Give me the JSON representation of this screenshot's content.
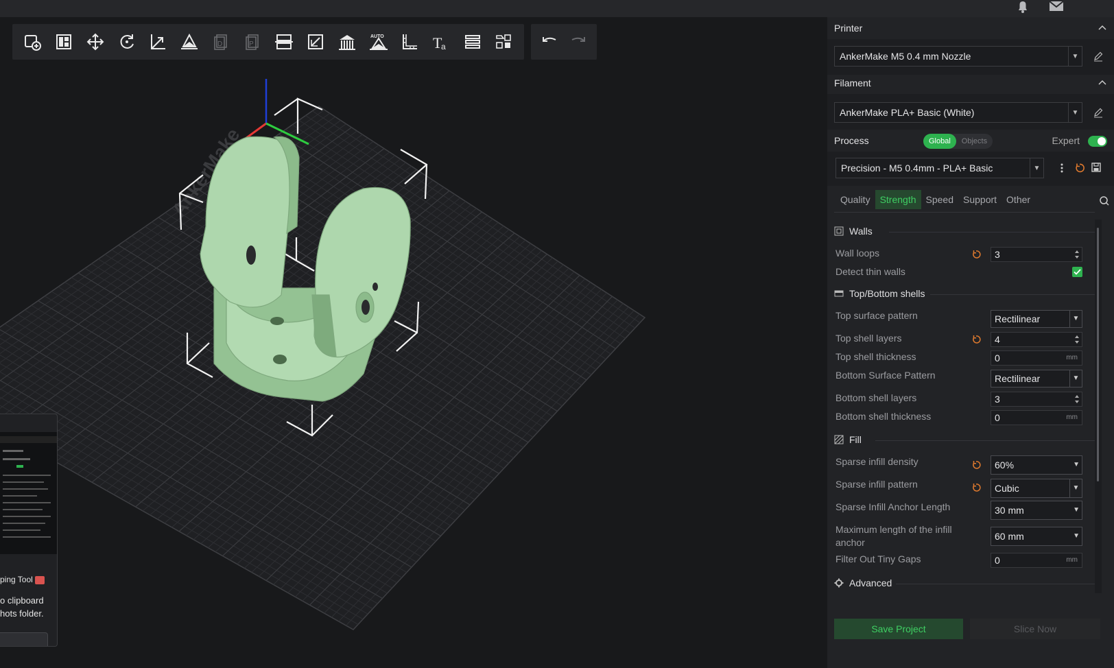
{
  "colors": {
    "accent": "#2eb24f",
    "accent_text": "#3fcf63",
    "model": "#a9d4a8",
    "reset_icon": "#e07a2e",
    "axis_x": "#e53935",
    "axis_y": "#2ecc40",
    "axis_z": "#1e3fd8"
  },
  "topbar": {
    "icons": [
      "bell-icon",
      "mail-icon"
    ]
  },
  "toolbar": {
    "tools": [
      {
        "name": "add-object-icon",
        "state": "enabled"
      },
      {
        "name": "arrange-icon",
        "state": "enabled"
      },
      {
        "name": "move-icon",
        "state": "enabled"
      },
      {
        "name": "rotate-icon",
        "state": "enabled"
      },
      {
        "name": "scale-icon",
        "state": "enabled"
      },
      {
        "name": "lay-on-face-icon",
        "state": "enabled"
      },
      {
        "name": "copy-icon",
        "state": "disabled"
      },
      {
        "name": "paste-icon",
        "state": "disabled"
      },
      {
        "name": "split-icon",
        "state": "enabled"
      },
      {
        "name": "cut-icon",
        "state": "enabled"
      },
      {
        "name": "support-paint-icon",
        "state": "enabled"
      },
      {
        "name": "auto-orient-icon",
        "state": "enabled",
        "text": "AUTO"
      },
      {
        "name": "measure-icon",
        "state": "enabled"
      },
      {
        "name": "text-icon",
        "state": "enabled"
      },
      {
        "name": "layers-icon",
        "state": "enabled"
      },
      {
        "name": "assembly-icon",
        "state": "enabled"
      }
    ],
    "undo": "undo-icon",
    "redo": "redo-icon"
  },
  "toast": {
    "title": "ping Tool",
    "message_line1": "o clipboard",
    "message_line2": "hots folder."
  },
  "printer": {
    "heading": "Printer",
    "value": "AnkerMake M5 0.4 mm Nozzle"
  },
  "filament": {
    "heading": "Filament",
    "value": "AnkerMake PLA+ Basic (White)"
  },
  "process": {
    "heading": "Process",
    "mode_global": "Global",
    "mode_objects": "Objects",
    "expert_label": "Expert",
    "expert_on": true,
    "value": "Precision - M5 0.4mm - PLA+ Basic"
  },
  "tabs": {
    "items": [
      "Quality",
      "Strength",
      "Speed",
      "Support",
      "Other"
    ],
    "active": "Strength"
  },
  "walls": {
    "title": "Walls",
    "wall_loops_label": "Wall loops",
    "wall_loops_value": "3",
    "detect_thin_label": "Detect thin walls",
    "detect_thin_checked": true
  },
  "shells": {
    "title": "Top/Bottom shells",
    "top_pattern_label": "Top surface pattern",
    "top_pattern_value": "Rectilinear",
    "top_layers_label": "Top shell layers",
    "top_layers_value": "4",
    "top_thickness_label": "Top shell thickness",
    "top_thickness_value": "0",
    "bottom_pattern_label": "Bottom Surface Pattern",
    "bottom_pattern_value": "Rectilinear",
    "bottom_layers_label": "Bottom shell layers",
    "bottom_layers_value": "3",
    "bottom_thickness_label": "Bottom shell thickness",
    "bottom_thickness_value": "0",
    "unit_mm": "mm"
  },
  "fill": {
    "title": "Fill",
    "density_label": "Sparse infill density",
    "density_value": "60%",
    "pattern_label": "Sparse infill pattern",
    "pattern_value": "Cubic",
    "anchor_label": "Sparse Infill Anchor Length",
    "anchor_value": "30 mm",
    "anchor_max_label_line1": "Maximum length of the infill",
    "anchor_max_label_line2": "anchor",
    "anchor_max_value": "60 mm",
    "tiny_gaps_label": "Filter Out Tiny Gaps",
    "tiny_gaps_value": "0",
    "unit_mm": "mm"
  },
  "advanced": {
    "title": "Advanced"
  },
  "actions": {
    "save": "Save Project",
    "slice": "Slice Now"
  }
}
